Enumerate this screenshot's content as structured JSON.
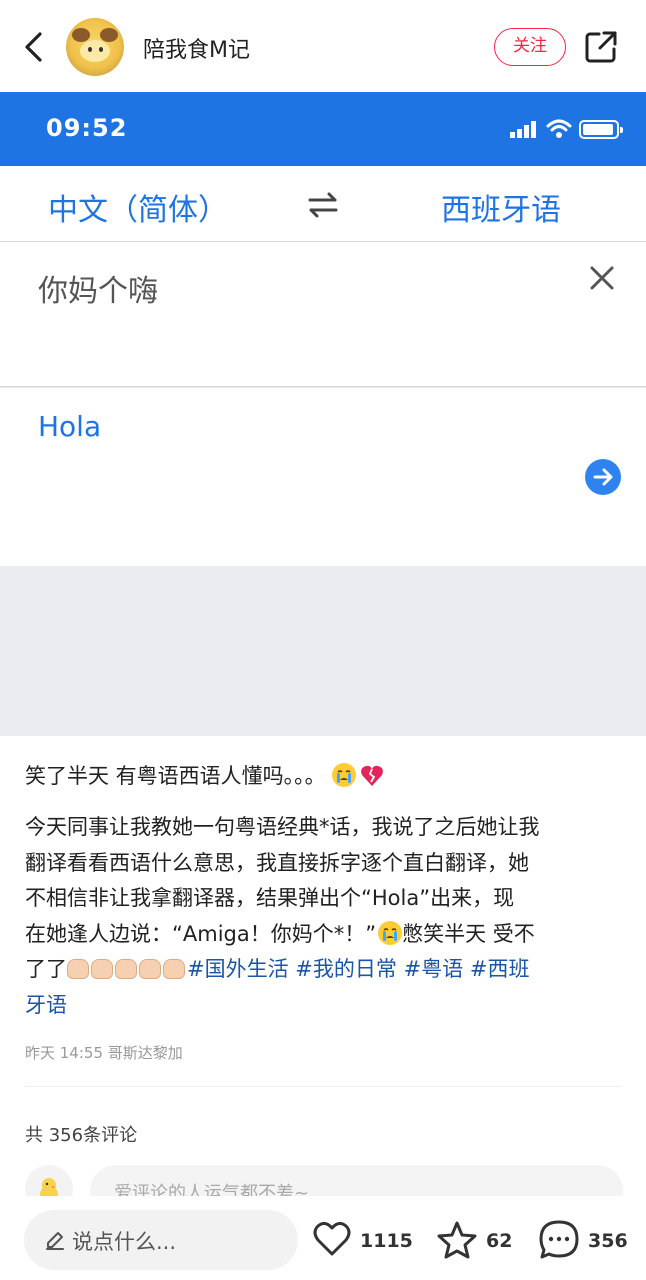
{
  "header": {
    "username": "陪我食M记",
    "follow_label": "关注"
  },
  "embedded_screenshot": {
    "status_time": "09:52",
    "source_language": "中文（简体）",
    "target_language": "西班牙语",
    "source_text": "你妈个嗨",
    "result_text": "Hola"
  },
  "post": {
    "title": "笑了半天 有粤语西语人懂吗。。。",
    "body_lines": [
      "今天同事让我教她一句粤语经典*话，我说了之后她让我",
      "翻译看看西语什么意思，我直接拆字逐个直白翻译，她",
      "不相信非让我拿翻译器，结果弹出个“Hola”出来，现",
      "在她逢人边说：“Amiga！你妈个*！”",
      "憋笑半天 受不",
      "了了",
      "牙语"
    ],
    "tags": [
      "#国外生活",
      "#我的日常",
      "#粤语",
      "#西班"
    ],
    "meta": "昨天 14:55 哥斯达黎加"
  },
  "comments": {
    "count_label": "共 356条评论",
    "input_placeholder": "爱评论的人运气都不差~"
  },
  "bottom_bar": {
    "say_placeholder": "说点什么...",
    "likes": "1115",
    "stars": "62",
    "comments": "356"
  },
  "colors": {
    "accent_blue": "#1f74e3",
    "follow_red": "#ff2442",
    "tag_blue": "#1a56a8"
  },
  "icons": [
    "back-arrow-icon",
    "share-icon",
    "signal-icon",
    "wifi-icon",
    "battery-icon",
    "swap-icon",
    "clear-icon",
    "arrow-right-icon",
    "pen-icon",
    "heart-icon",
    "star-icon",
    "comment-icon"
  ]
}
